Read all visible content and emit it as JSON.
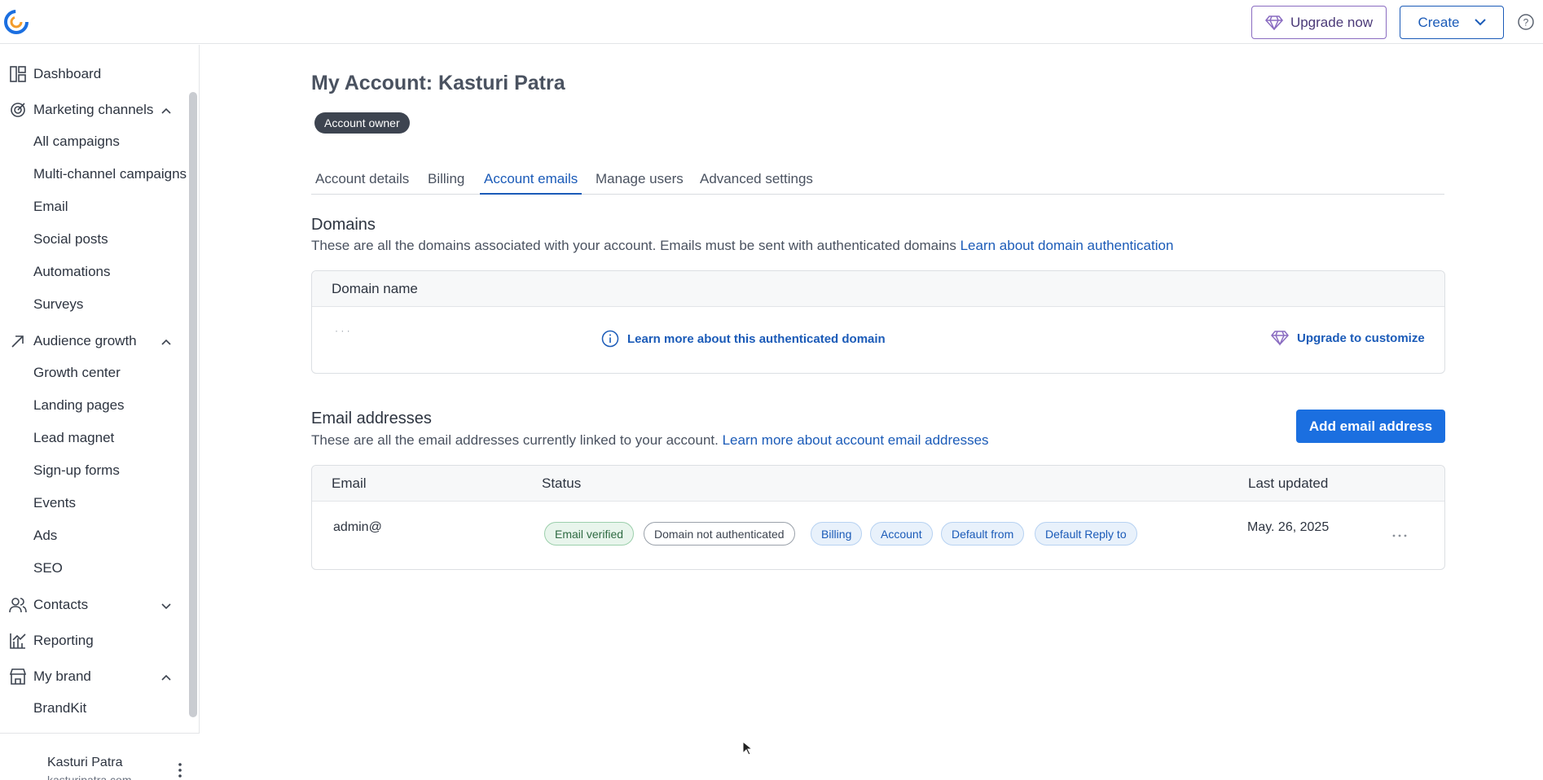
{
  "topbar": {
    "logo_icon": "constant-contact-logo",
    "upgrade_label": "Upgrade now",
    "create_label": "Create",
    "help_icon": "help-circle-icon"
  },
  "sidebar": {
    "items": [
      {
        "label": "Dashboard",
        "icon": "dashboard-icon"
      },
      {
        "label": "Marketing channels",
        "icon": "marketing-icon",
        "expanded": true,
        "children": [
          "All campaigns",
          "Multi-channel campaigns",
          "Email",
          "Social posts",
          "Automations",
          "Surveys"
        ]
      },
      {
        "label": "Audience growth",
        "icon": "trend-arrow-icon",
        "expanded": true,
        "children": [
          "Growth center",
          "Landing pages",
          "Lead magnet",
          "Sign-up forms",
          "Events",
          "Ads",
          "SEO"
        ]
      },
      {
        "label": "Contacts",
        "icon": "contacts-icon",
        "expanded": false
      },
      {
        "label": "Reporting",
        "icon": "reporting-icon"
      },
      {
        "label": "My brand",
        "icon": "store-icon",
        "expanded": true,
        "children": [
          "BrandKit"
        ]
      }
    ],
    "user": {
      "name": "Kasturi Patra",
      "email": "kasturipatra.com"
    }
  },
  "page": {
    "title": "My Account: Kasturi Patra",
    "badge": "Account owner",
    "tabs": [
      "Account details",
      "Billing",
      "Account emails",
      "Manage users",
      "Advanced settings"
    ],
    "active_tab": "Account emails"
  },
  "domains": {
    "title": "Domains",
    "desc": "These are all the domains associated with your account. Emails must be sent with authenticated domains ",
    "desc_link": "Learn about domain authentication",
    "header": "Domain name",
    "row_domain": "·  ·  ·",
    "learn_more": "Learn more about this authenticated domain",
    "upgrade": "Upgrade to customize"
  },
  "emails": {
    "title": "Email addresses",
    "desc": "These are all the email addresses currently linked to your account. ",
    "desc_link": "Learn more about account email addresses",
    "add_button": "Add email address",
    "headers": {
      "email": "Email",
      "status": "Status",
      "updated": "Last updated"
    },
    "row": {
      "email": "admin@",
      "statuses": [
        "Email verified",
        "Domain not authenticated",
        "Billing",
        "Account",
        "Default from",
        "Default Reply to"
      ],
      "updated": "May. 26, 2025"
    }
  },
  "colors": {
    "accent": "#1b5bb8",
    "primary_button": "#1b6fe0",
    "upgrade": "#8a6cc1"
  }
}
